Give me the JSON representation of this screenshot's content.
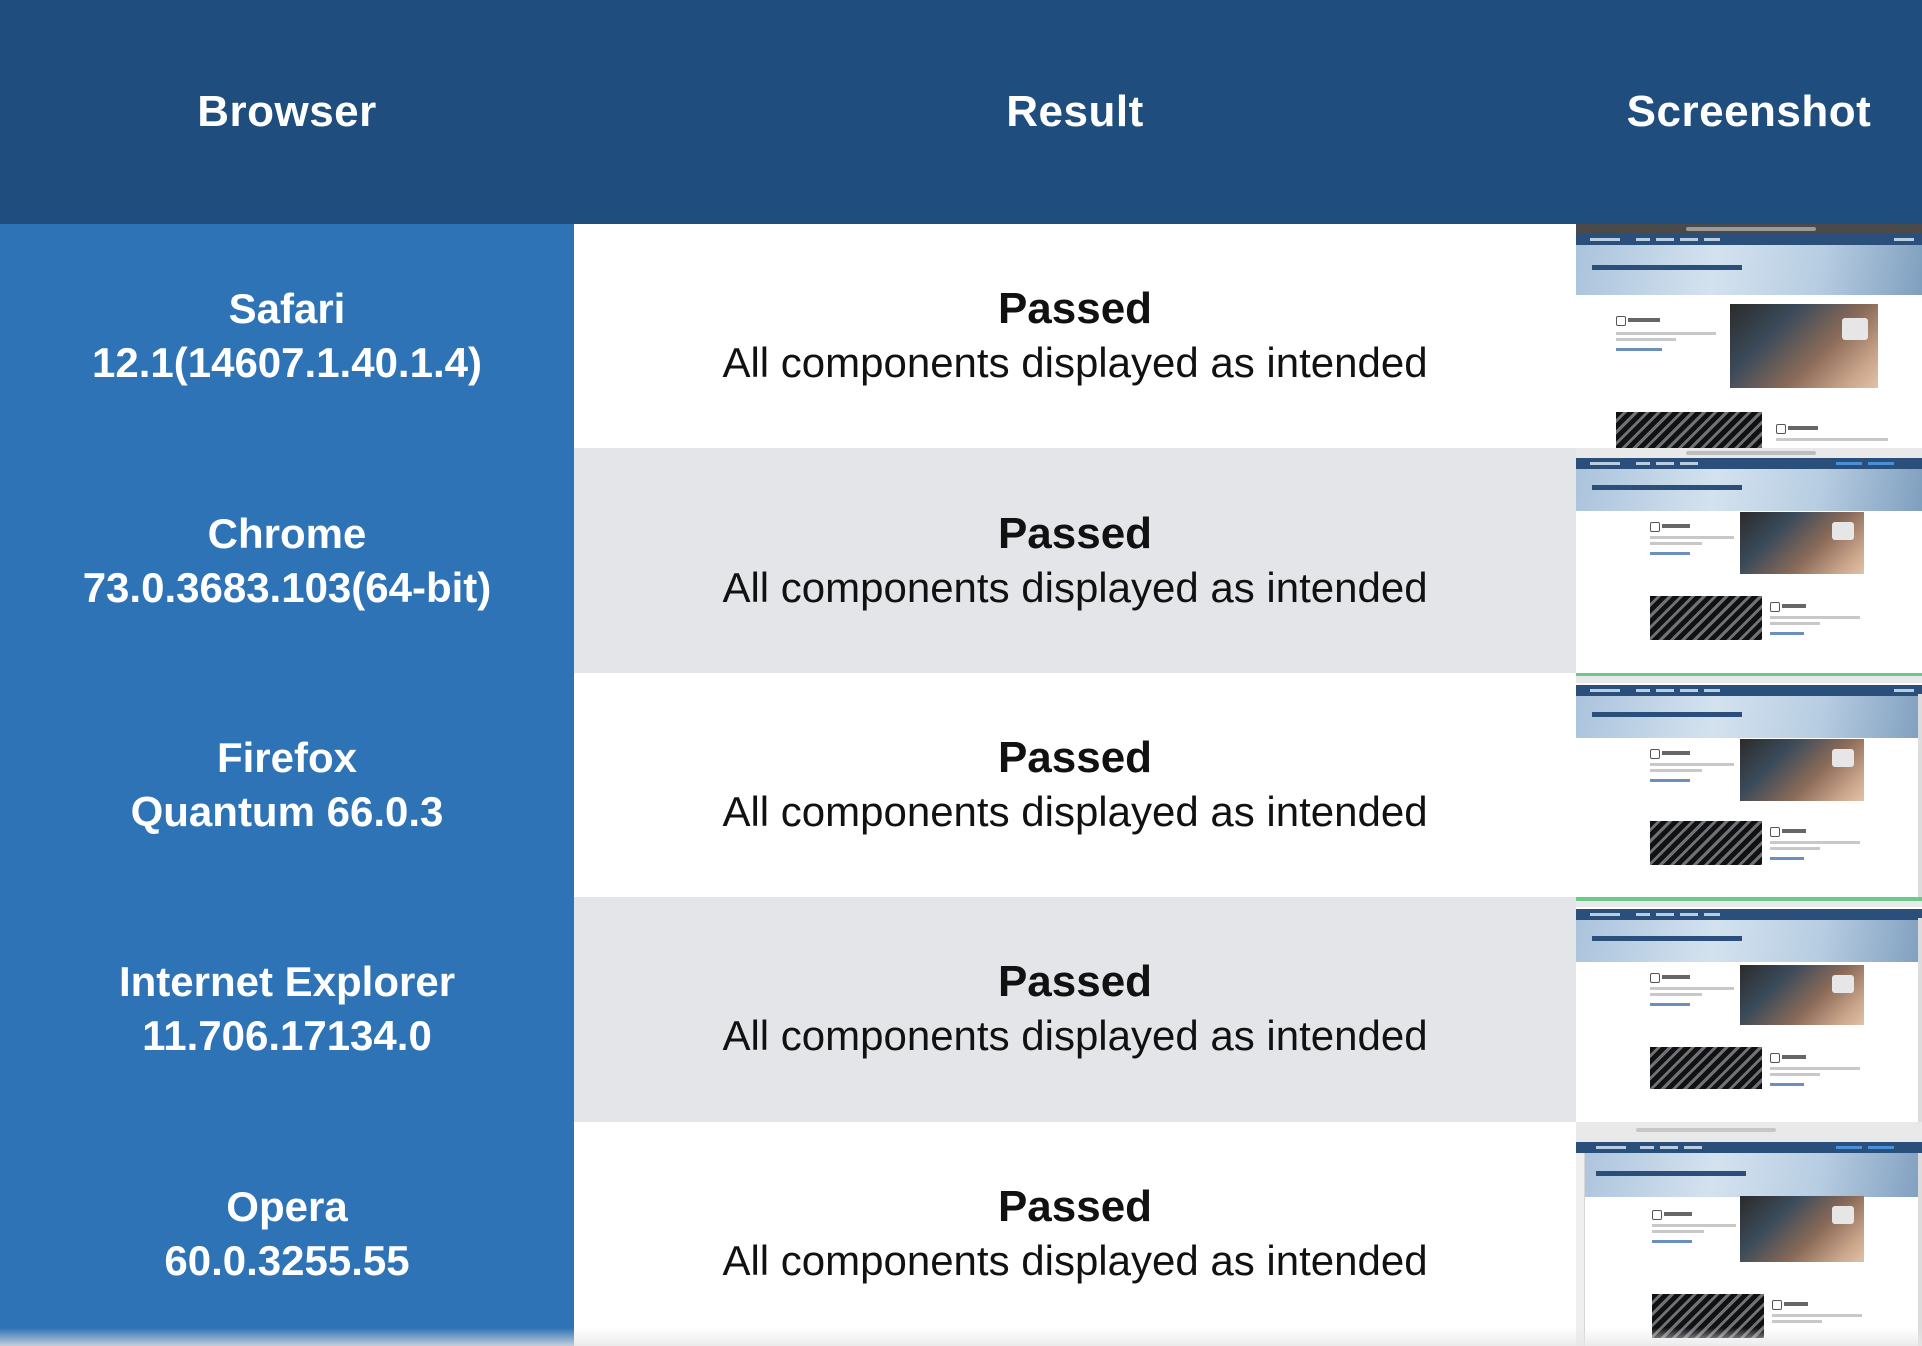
{
  "header": {
    "browser": "Browser",
    "result": "Result",
    "screenshot": "Screenshot"
  },
  "rows": [
    {
      "browser_name": "Safari",
      "browser_version": "12.1(14607.1.40.1.4)",
      "status": "Passed",
      "description": "All components displayed as intended"
    },
    {
      "browser_name": "Chrome",
      "browser_version": "73.0.3683.103(64-bit)",
      "status": "Passed",
      "description": "All components displayed as intended"
    },
    {
      "browser_name": "Firefox",
      "browser_version": "Quantum 66.0.3",
      "status": "Passed",
      "description": "All components displayed as intended"
    },
    {
      "browser_name": "Internet Explorer",
      "browser_version": "11.706.17134.0",
      "status": "Passed",
      "description": "All components displayed as intended"
    },
    {
      "browser_name": "Opera",
      "browser_version": "60.0.3255.55",
      "status": "Passed",
      "description": "All components displayed as intended"
    }
  ],
  "colors": {
    "header_bg": "#1f4e7e",
    "browser_col_bg": "#2f73b7",
    "alt_row_bg": "#e4e5e8",
    "text_white": "#ffffff",
    "text_dark": "#111111"
  }
}
